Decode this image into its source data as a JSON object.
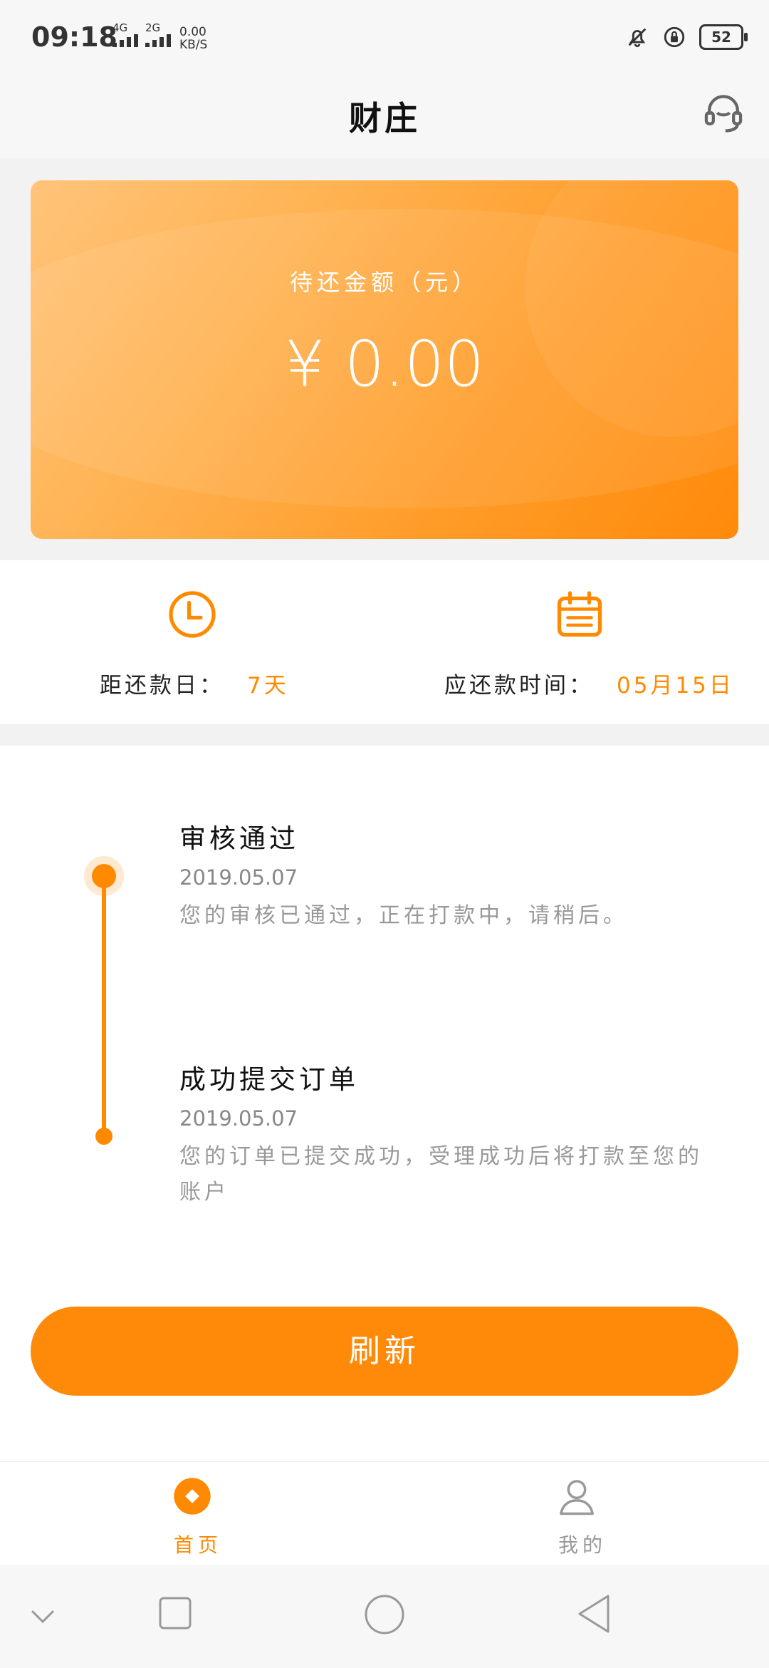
{
  "status_bar": {
    "time": "09:18",
    "net1": "4G",
    "net2": "2G",
    "speed_value": "0.00",
    "speed_unit": "KB/S",
    "battery": "52"
  },
  "header": {
    "title": "财庄",
    "support_icon": "headset-icon"
  },
  "amount_card": {
    "label": "待还金额（元）",
    "value": "¥ 0.00"
  },
  "info": {
    "days_label": "距还款日：",
    "days_value": "7天",
    "due_label": "应还款时间：",
    "due_value": "05月15日"
  },
  "timeline": [
    {
      "title": "审核通过",
      "date": "2019.05.07",
      "desc": "您的审核已通过，正在打款中，请稍后。"
    },
    {
      "title": "成功提交订单",
      "date": "2019.05.07",
      "desc": "您的订单已提交成功，受理成功后将打款至您的账户"
    }
  ],
  "refresh_button": "刷新",
  "tabs": [
    {
      "label": "首页",
      "icon": "home-coin-icon",
      "active": true
    },
    {
      "label": "我的",
      "icon": "user-icon",
      "active": false
    }
  ],
  "colors": {
    "accent": "#ff8a00",
    "inactive": "#999999"
  }
}
